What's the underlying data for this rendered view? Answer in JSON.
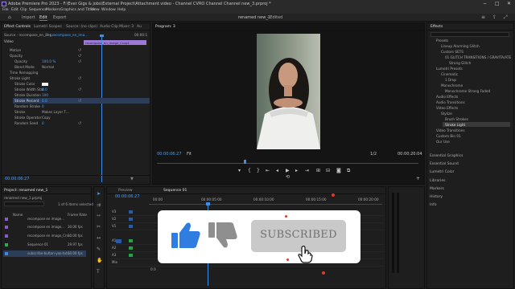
{
  "app": {
    "title": "Adobe Premiere Pro 2023 - F:\\Ever Gigs & jobs\\External Project\\Attachment video - Channel CVRO Channel Channel new_3.prproj *",
    "window_controls": [
      "−",
      "□",
      "✕"
    ]
  },
  "menu": [
    "File",
    "Edit",
    "Clip",
    "Sequence",
    "Markers",
    "Graphics and Titles",
    "View",
    "Window",
    "Help"
  ],
  "workspace": {
    "tabs": [
      "Import",
      "Edit",
      "Export"
    ],
    "active": "Edit",
    "sequence_title": "renamed new_1",
    "sequence_suffix": "- Edited"
  },
  "effect_controls": {
    "tabs": [
      "Effect Controls",
      "Lumetri Scopes",
      "Source: (no clips)",
      "Audio Clip Mixer: 3",
      "Au"
    ],
    "source_label": "Source - recompose_en_img...",
    "sequence_label": "3 • recompose_en_ima...",
    "timecode_head": "00:00:1",
    "clip_label": "recompose_en_image_Crop4",
    "section_video": "Video",
    "rows": [
      {
        "name": "Motion",
        "value": ""
      },
      {
        "name": "Opacity",
        "value": ""
      },
      {
        "name": "Opacity",
        "value": "100.0 %"
      },
      {
        "name": "Blend Mode",
        "value": "Normal"
      },
      {
        "name": "Time Remapping",
        "value": ""
      },
      {
        "name": "Stroke Light",
        "value": ""
      },
      {
        "name": "Stroke Color",
        "value": ""
      },
      {
        "name": "Stroke Width Stat",
        "value": "0.0"
      },
      {
        "name": "Stroke Duration",
        "value": "100"
      },
      {
        "name": "Stroke Percent",
        "value": "0.0"
      },
      {
        "name": "Random Stroke",
        "value": "0"
      },
      {
        "name": "Stroke",
        "value": "Makes Layer T..."
      },
      {
        "name": "Stroke Operator",
        "value": "Copy"
      },
      {
        "name": "Random Seed",
        "value": "0"
      }
    ],
    "timecode": "00:00:06:27"
  },
  "program": {
    "tab": "Program: 3",
    "timecode": "00:00:06:27",
    "fit": "Fit",
    "quality": "1/2",
    "duration": "00:00:20:04"
  },
  "effects_panel": {
    "tab": "Effects",
    "tree": [
      {
        "label": "Presets",
        "depth": 0
      },
      {
        "label": "Lineup Alarming Glitch",
        "depth": 1
      },
      {
        "label": "Custom SETS",
        "depth": 1
      },
      {
        "label": "01 GLITCH TRANSITIONS / GRAVITA/ATE",
        "depth": 2
      },
      {
        "label": "Strong Glitch",
        "depth": 3
      },
      {
        "label": "Lumetri Presets",
        "depth": 0
      },
      {
        "label": "Cinematic",
        "depth": 1
      },
      {
        "label": "1 Drop",
        "depth": 2
      },
      {
        "label": "Monochrome",
        "depth": 1
      },
      {
        "label": "Monochrome Strong Faded",
        "depth": 2
      },
      {
        "label": "Audio Effects",
        "depth": 0
      },
      {
        "label": "Audio Transitions",
        "depth": 0
      },
      {
        "label": "Video Effects",
        "depth": 0
      },
      {
        "label": "Stylize",
        "depth": 1
      },
      {
        "label": "Brush Strokes",
        "depth": 2
      },
      {
        "label": "Stroke Light",
        "depth": 2
      },
      {
        "label": "Video Transitions",
        "depth": 0
      },
      {
        "label": "Custom Bin 01",
        "depth": 0
      },
      {
        "label": "Our Use",
        "depth": 0
      }
    ],
    "sections": [
      "Essential Graphics",
      "Essential Sound",
      "Lumetri Color",
      "Libraries",
      "Markers",
      "History",
      "Info"
    ]
  },
  "project": {
    "tab": "Project: renamed new_1",
    "bin_label": "renamed new_1.prproj",
    "count": "1 of 6 items selected",
    "col_name": "Name",
    "col_rate": "Frame Rate",
    "items": [
      {
        "name": "recompose en image...",
        "rate": "",
        "color": "#8a5cc7"
      },
      {
        "name": "recompose en image...",
        "rate": "30.00 fps",
        "color": "#8a5cc7"
      },
      {
        "name": "recompose en image_Crn...",
        "rate": "30.00 fps",
        "color": "#8a5cc7"
      },
      {
        "name": "Sequence 01",
        "rate": "29.97 fps",
        "color": "#2fa84f"
      },
      {
        "name": "subscribe-button-yoo-tut...",
        "rate": "60.00 fps",
        "color": "#3e87d9"
      }
    ]
  },
  "timeline": {
    "tabs": [
      "Preview",
      "Sequence 01"
    ],
    "timecode": "00:00:06:27",
    "ruler": [
      "00:00",
      "00:00:05:00",
      "00:00:10:00",
      "00:00:15:00",
      "00:00:20:00"
    ],
    "tracks": [
      "V3",
      "V2",
      "V1",
      "A1",
      "A2",
      "A3",
      "Mix"
    ],
    "mix_value": "0.0"
  },
  "overlay": {
    "subscribe_text": "SUBSCRIBED",
    "like_color": "#2f7de1",
    "dislike_color": "#8f8f8f"
  }
}
